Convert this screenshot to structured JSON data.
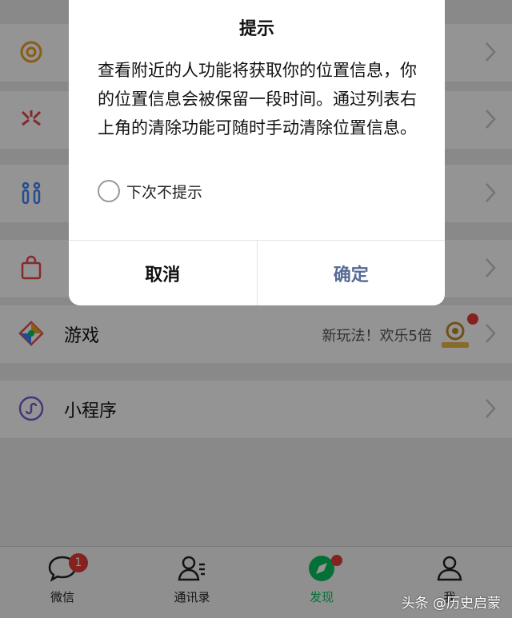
{
  "list": {
    "rows": [
      {
        "label": "",
        "icon": "moments-icon"
      },
      {
        "label": "",
        "icon": "scan-icon"
      },
      {
        "label": "",
        "icon": "people-nearby-icon"
      },
      {
        "label": "",
        "icon": "shopping-bag-icon"
      },
      {
        "label": "游戏",
        "icon": "game-icon",
        "extra": "新玩法！欢乐5倍"
      },
      {
        "label": "小程序",
        "icon": "mini-program-icon"
      }
    ]
  },
  "dialog": {
    "title": "提示",
    "message": "查看附近的人功能将获取你的位置信息，你的位置信息会被保留一段时间。通过列表右上角的清除功能可随时手动清除位置信息。",
    "checkbox_label": "下次不提示",
    "cancel_label": "取消",
    "confirm_label": "确定"
  },
  "tabbar": {
    "tabs": [
      {
        "label": "微信",
        "badge": "1",
        "icon": "chat-icon"
      },
      {
        "label": "通讯录",
        "icon": "contacts-icon"
      },
      {
        "label": "发现",
        "icon": "discover-icon",
        "active": true
      },
      {
        "label": "我",
        "icon": "profile-icon"
      }
    ]
  },
  "watermark": "头条 @历史启蒙",
  "colors": {
    "accent_green": "#07c160",
    "dialog_confirm": "#576b95",
    "badge_red": "#e53935"
  }
}
